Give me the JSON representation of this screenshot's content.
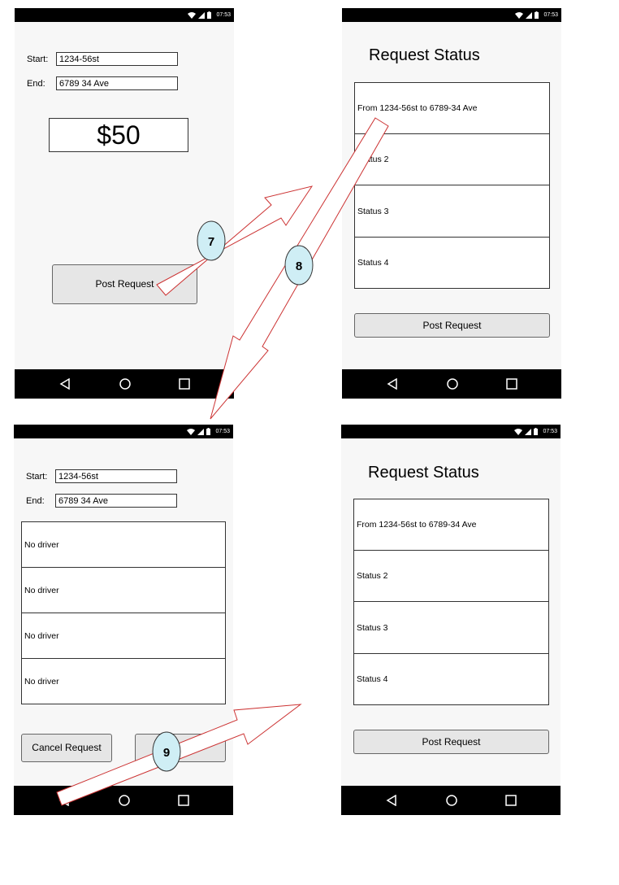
{
  "status_time": "07:53",
  "screen1": {
    "start_label": "Start:",
    "start_value": "1234-56st",
    "end_label": "End:",
    "end_value": "6789 34 Ave",
    "price": "$50",
    "post_button": "Post Request"
  },
  "screen2": {
    "title": "Request Status",
    "rows": [
      "From 1234-56st to 6789-34 Ave",
      "Status 2",
      "Status 3",
      "Status 4"
    ],
    "post_button": "Post Request"
  },
  "screen3": {
    "start_label": "Start:",
    "start_value": "1234-56st",
    "end_label": "End:",
    "end_value": "6789 34 Ave",
    "rows": [
      "No driver",
      "No driver",
      "No driver",
      "No driver"
    ],
    "cancel_button": "Cancel Request"
  },
  "screen4": {
    "title": "Request Status",
    "rows": [
      "From 1234-56st to 6789-34 Ave",
      "Status 2",
      "Status 3",
      "Status 4"
    ],
    "post_button": "Post Request"
  },
  "steps": [
    "7",
    "8",
    "9"
  ],
  "colors": {
    "arrow_stroke": "#cc3333",
    "marker_fill": "#cfeef5",
    "statusbar": "#000000"
  }
}
